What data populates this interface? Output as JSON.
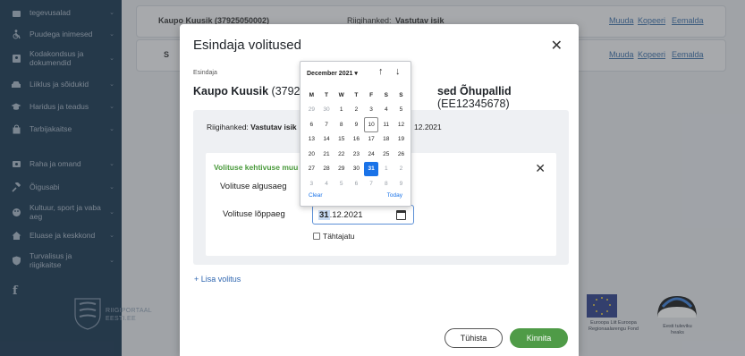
{
  "sidebar": {
    "items": [
      {
        "label": "tegevusalad"
      },
      {
        "label": "Puudega inimesed"
      },
      {
        "label": "Kodakondsus ja dokumendid"
      },
      {
        "label": "Liiklus ja sõidukid"
      },
      {
        "label": "Haridus ja teadus"
      },
      {
        "label": "Tarbijakaitse"
      },
      {
        "label": "Raha ja omand"
      },
      {
        "label": "Õigusabi"
      },
      {
        "label": "Kultuur, sport ja vaba aeg"
      },
      {
        "label": "Eluase ja keskkond"
      },
      {
        "label": "Turvalisus ja riigikaitse"
      }
    ],
    "facebook": "f",
    "portal_name_line1": "RIIGIPORTAAL",
    "portal_name_line2": "EESTI.EE"
  },
  "background": {
    "row1_person": "Kaupo Kuusik (37925050002)",
    "row1_rights_label": "Riigihanked:",
    "row1_rights_value": "Vastutav isik",
    "row2_prefix": "S",
    "links": [
      "Muuda",
      "Kopeeri",
      "Eemalda"
    ]
  },
  "footer_logos": {
    "eu_text": "Euroopa Liit Euroopa Regionaalarengu Fond",
    "est_text": "Eesti tuleviku heaks"
  },
  "modal": {
    "title": "Esindaja volitused",
    "esindaja_label": "Esindaja",
    "rep_name_bold": "Kaupo Kuusik",
    "rep_code": "(3792505",
    "company_bold": "sed Õhupallid",
    "company_code": "(EE12345678)",
    "rights_label": "Riigihanked:",
    "rights_value": "Vastutav isik",
    "rights_end_date": "12.2021",
    "validity_title": "Volituse kehtivuse muu",
    "start_label": "Volituse algusaeg",
    "end_label": "Volituse lõppaeg",
    "end_value_day": "31",
    "end_value_rest": ".12.2021",
    "indefinite_label": "Tähtajatu",
    "add_link": "+ Lisa volitus",
    "cancel_button": "Tühista",
    "confirm_button": "Kinnita"
  },
  "datepicker": {
    "month_label": "December 2021 ▾",
    "weekdays": [
      "M",
      "T",
      "W",
      "T",
      "F",
      "S",
      "S"
    ],
    "weeks": [
      [
        {
          "d": "29",
          "o": 1
        },
        {
          "d": "30",
          "o": 1
        },
        {
          "d": "1"
        },
        {
          "d": "2"
        },
        {
          "d": "3"
        },
        {
          "d": "4"
        },
        {
          "d": "5"
        }
      ],
      [
        {
          "d": "6"
        },
        {
          "d": "7"
        },
        {
          "d": "8"
        },
        {
          "d": "9"
        },
        {
          "d": "10",
          "t": 1
        },
        {
          "d": "11"
        },
        {
          "d": "12"
        }
      ],
      [
        {
          "d": "13"
        },
        {
          "d": "14"
        },
        {
          "d": "15"
        },
        {
          "d": "16"
        },
        {
          "d": "17"
        },
        {
          "d": "18"
        },
        {
          "d": "19"
        }
      ],
      [
        {
          "d": "20"
        },
        {
          "d": "21"
        },
        {
          "d": "22"
        },
        {
          "d": "23"
        },
        {
          "d": "24"
        },
        {
          "d": "25"
        },
        {
          "d": "26"
        }
      ],
      [
        {
          "d": "27"
        },
        {
          "d": "28"
        },
        {
          "d": "29"
        },
        {
          "d": "30"
        },
        {
          "d": "31",
          "s": 1
        },
        {
          "d": "1",
          "o": 1
        },
        {
          "d": "2",
          "o": 1
        }
      ],
      [
        {
          "d": "3",
          "o": 1
        },
        {
          "d": "4",
          "o": 1
        },
        {
          "d": "5",
          "o": 1
        },
        {
          "d": "6",
          "o": 1
        },
        {
          "d": "7",
          "o": 1
        },
        {
          "d": "8",
          "o": 1
        },
        {
          "d": "9",
          "o": 1
        }
      ]
    ],
    "clear_label": "Clear",
    "today_label": "Today",
    "accent_color": "#1a73e8"
  }
}
